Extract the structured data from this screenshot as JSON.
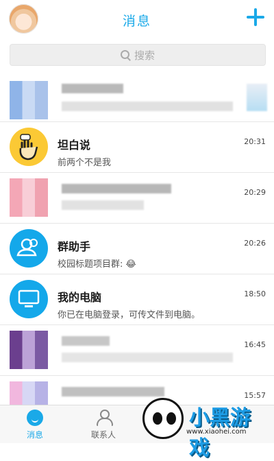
{
  "header": {
    "title": "消息"
  },
  "search": {
    "placeholder": "搜索"
  },
  "conversations": [
    {
      "name": "",
      "message": "",
      "time": ""
    },
    {
      "name": "坦白说",
      "message": "前两个不是我",
      "time": "20:31"
    },
    {
      "name": "",
      "message": "",
      "time": "20:29"
    },
    {
      "name": "群助手",
      "message": "校园标题项目群: 😂",
      "time": "20:26"
    },
    {
      "name": "我的电脑",
      "message": "你已在电脑登录，可传文件到电脑。",
      "time": "18:50"
    },
    {
      "name": "",
      "message": "",
      "time": "16:45"
    },
    {
      "name": "",
      "message": "",
      "time": "15:57"
    }
  ],
  "tabs": [
    {
      "label": "消息"
    },
    {
      "label": "联系人"
    }
  ],
  "watermark": {
    "text": "小黑游戏",
    "url": "www.xiaohei.com"
  },
  "colors": {
    "accent": "#1aa9e8",
    "yellow_avatar": "#fbc935",
    "blue_avatar": "#14a8ea"
  }
}
